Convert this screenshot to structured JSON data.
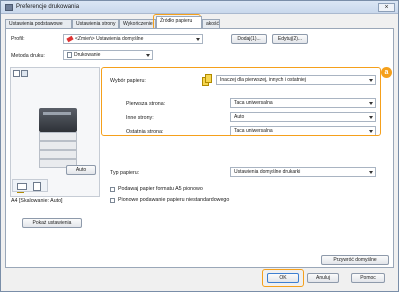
{
  "window": {
    "title": "Preferencje drukowania",
    "close": "×"
  },
  "tabs": [
    {
      "label": "Ustawienia podstawowe"
    },
    {
      "label": "Ustawienia strony"
    },
    {
      "label": "Wykończenie"
    },
    {
      "label": "Źródło papieru"
    },
    {
      "label": "akość"
    }
  ],
  "profile": {
    "label": "Profil:",
    "value": "<Zmień> Ustawienia domyślne",
    "add": "Dodaj(1)...",
    "edit": "Edytuj(2)..."
  },
  "print_method": {
    "label": "Metoda druku:",
    "value": "Drukowanie"
  },
  "paper_selection": {
    "label": "Wybór papieru:",
    "value": "Inaczej dla pierwszej, innych i ostatniej"
  },
  "first_page": {
    "label": "Pierwsza strona:",
    "value": "Taca uniwersalna"
  },
  "other_pages": {
    "label": "Inne strony:",
    "value": "Auto"
  },
  "last_page": {
    "label": "Ostatnia strona:",
    "value": "Taca uniwersalna"
  },
  "badge": "a",
  "preview": {
    "auto_btn": "Auto",
    "status": "A4 [Skalowanie: Auto]",
    "show_settings": "Pokaż ustawienia"
  },
  "paper_type": {
    "label": "Typ papieru:",
    "value": "Ustawienia domyślne drukarki"
  },
  "checkbox_a5": "Podawaj papier formatu A5 pionowo",
  "checkbox_nonstandard": "Pionowe podawanie papieru niestandardowego",
  "restore_defaults": "Przywróć domyślne",
  "footer": {
    "ok": "OK",
    "cancel": "Anuluj",
    "help": "Pomoc"
  },
  "colors": {
    "highlight": "#f5a01b"
  }
}
